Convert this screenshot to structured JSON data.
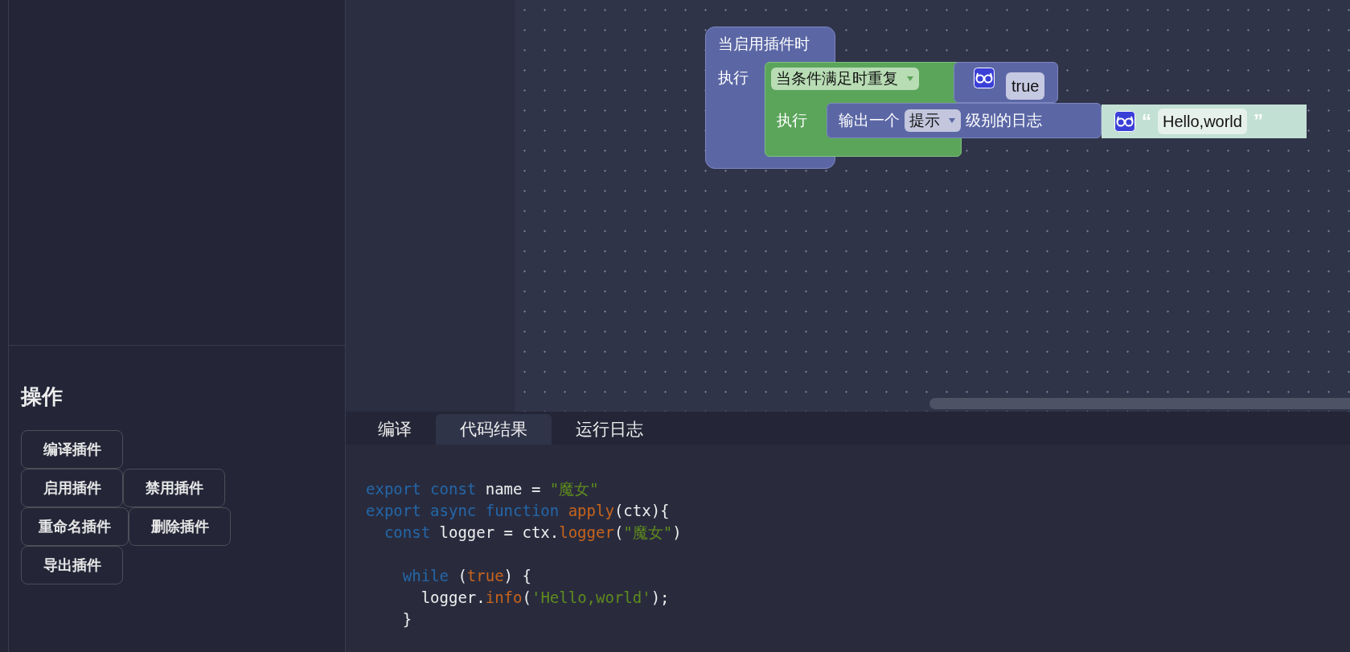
{
  "sidebar": {
    "heading": "操作",
    "button_rows": [
      [
        "编译插件"
      ],
      [
        "启用插件",
        "禁用插件"
      ],
      [
        "重命名插件",
        "删除插件"
      ],
      [
        "导出插件"
      ]
    ]
  },
  "blocks": {
    "hat": {
      "title": "当启用插件时",
      "label": "执行"
    },
    "loop": {
      "dropdown": "当条件满足时重复",
      "label": "执行"
    },
    "condition": {
      "value": "true"
    },
    "log": {
      "before": "输出一个",
      "dropdown": "提示",
      "after": "级别的日志"
    },
    "text": {
      "open_quote": "“",
      "value": "Hello,world",
      "close_quote": "”"
    }
  },
  "tabs": [
    {
      "label": "编译",
      "selected": false
    },
    {
      "label": "代码结果",
      "selected": true
    },
    {
      "label": "运行日志",
      "selected": false
    }
  ],
  "code": [
    {
      "tokens": [
        {
          "kind": "keyword",
          "text": "export const"
        },
        {
          "kind": "plain",
          "text": " name = "
        },
        {
          "kind": "string",
          "text": "\"魔女\""
        }
      ]
    },
    {
      "tokens": [
        {
          "kind": "keyword",
          "text": "export async function "
        },
        {
          "kind": "call",
          "text": "apply"
        },
        {
          "kind": "plain",
          "text": "(ctx){"
        }
      ]
    },
    {
      "tokens": [
        {
          "kind": "keyword",
          "text": "  const"
        },
        {
          "kind": "plain",
          "text": " logger = ctx."
        },
        {
          "kind": "call",
          "text": "logger"
        },
        {
          "kind": "plain",
          "text": "("
        },
        {
          "kind": "string",
          "text": "\"魔女\""
        },
        {
          "kind": "plain",
          "text": ")"
        }
      ]
    },
    {
      "blank_before": true,
      "tokens": [
        {
          "kind": "keyword",
          "text": "    while"
        },
        {
          "kind": "plain",
          "text": " ("
        },
        {
          "kind": "call",
          "text": "true"
        },
        {
          "kind": "plain",
          "text": ") {"
        }
      ]
    },
    {
      "tokens": [
        {
          "kind": "plain",
          "text": "      logger."
        },
        {
          "kind": "call",
          "text": "info"
        },
        {
          "kind": "plain",
          "text": "("
        },
        {
          "kind": "string",
          "text": "'Hello,world'"
        },
        {
          "kind": "plain",
          "text": ");"
        }
      ]
    },
    {
      "tokens": [
        {
          "kind": "plain",
          "text": "    }"
        }
      ]
    }
  ]
}
